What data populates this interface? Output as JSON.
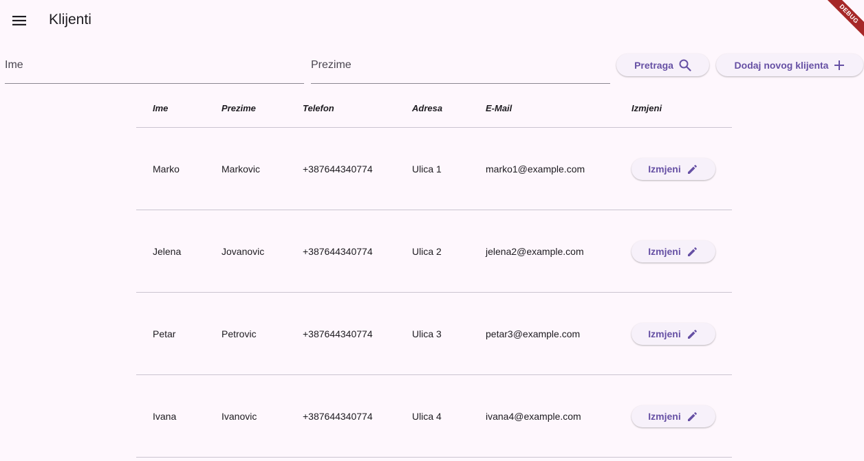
{
  "appbar": {
    "title": "Klijenti",
    "menu_icon": "menu-icon",
    "debug_banner": "DEBUG"
  },
  "search": {
    "ime_placeholder": "Ime",
    "prezime_placeholder": "Prezime",
    "search_label": "Pretraga",
    "search_icon": "search-icon",
    "add_label": "Dodaj novog klijenta",
    "add_icon": "plus-icon"
  },
  "table": {
    "headers": [
      "Ime",
      "Prezime",
      "Telefon",
      "Adresa",
      "E-Mail",
      "Izmjeni"
    ],
    "rows": [
      {
        "ime": "Marko",
        "prezime": "Markovic",
        "telefon": "+387644340774",
        "adresa": "Ulica 1",
        "email": "marko1@example.com",
        "action": "Izmjeni"
      },
      {
        "ime": "Jelena",
        "prezime": "Jovanovic",
        "telefon": "+387644340774",
        "adresa": "Ulica 2",
        "email": "jelena2@example.com",
        "action": "Izmjeni"
      },
      {
        "ime": "Petar",
        "prezime": "Petrovic",
        "telefon": "+387644340774",
        "adresa": "Ulica 3",
        "email": "petar3@example.com",
        "action": "Izmjeni"
      },
      {
        "ime": "Ivana",
        "prezime": "Ivanovic",
        "telefon": "+387644340774",
        "adresa": "Ulica 4",
        "email": "ivana4@example.com",
        "action": "Izmjeni"
      }
    ],
    "edit_icon": "pencil-icon"
  },
  "colors": {
    "background": "#fef7fd",
    "accent": "#6650a4",
    "button_bg": "#f7f1fa",
    "divider": "#cac4d0",
    "debug_ribbon": "#a62828"
  }
}
